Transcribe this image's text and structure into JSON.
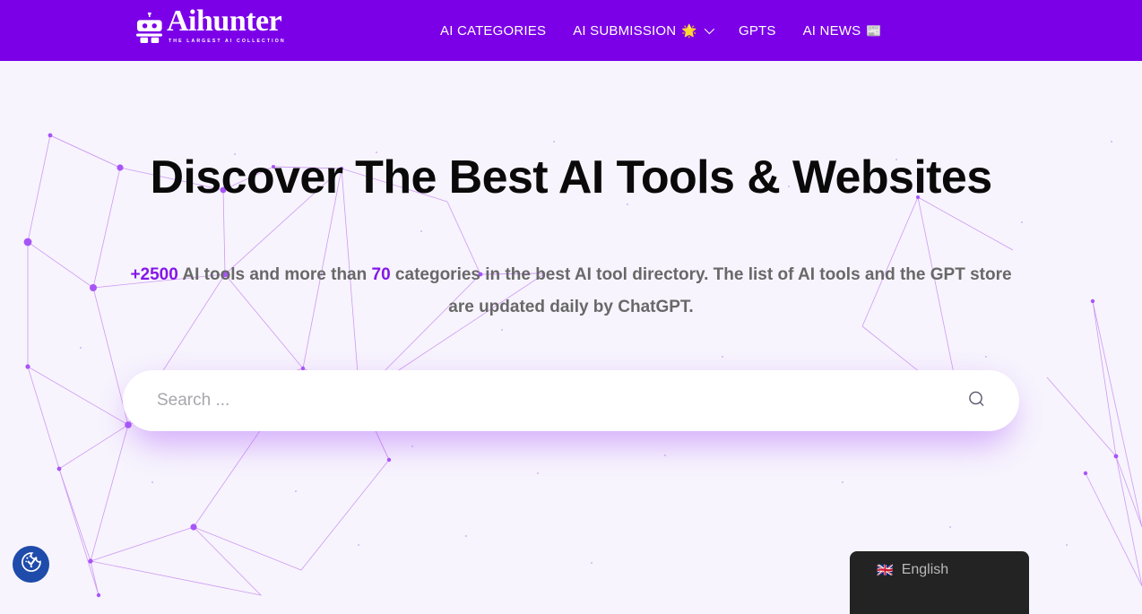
{
  "brand": {
    "name": "Aihunter",
    "tagline": "THE LARGEST AI COLLECTION",
    "logo_icon": "robot-icon",
    "header_color": "#7b00e8"
  },
  "nav": {
    "items": [
      {
        "label": "AI CATEGORIES",
        "emoji": "",
        "has_dropdown": false
      },
      {
        "label": "AI SUBMISSION",
        "emoji": "🌟",
        "has_dropdown": true
      },
      {
        "label": "GPTS",
        "emoji": "",
        "has_dropdown": false
      },
      {
        "label": "AI NEWS",
        "emoji": "📰",
        "has_dropdown": false
      }
    ]
  },
  "hero": {
    "headline": "Discover The Best AI Tools & Websites",
    "subhead": {
      "count_tools": "+2500",
      "part1": " AI tools and more than ",
      "count_categories": "70",
      "part2": " categories in the best AI tool directory. The list of AI tools and the GPT store are updated daily by ChatGPT."
    },
    "accent_color": "#8317e8",
    "background_color": "#f7f4fd",
    "background_pattern": "network-constellation"
  },
  "search": {
    "placeholder": "Search ...",
    "value": "",
    "icon": "search-icon"
  },
  "accessibility_widget": {
    "icon": "accessibility-cookie-icon",
    "color": "#1f4bab"
  },
  "language_switcher": {
    "flag": "🇬🇧",
    "label": "English",
    "background_color": "#232323"
  }
}
